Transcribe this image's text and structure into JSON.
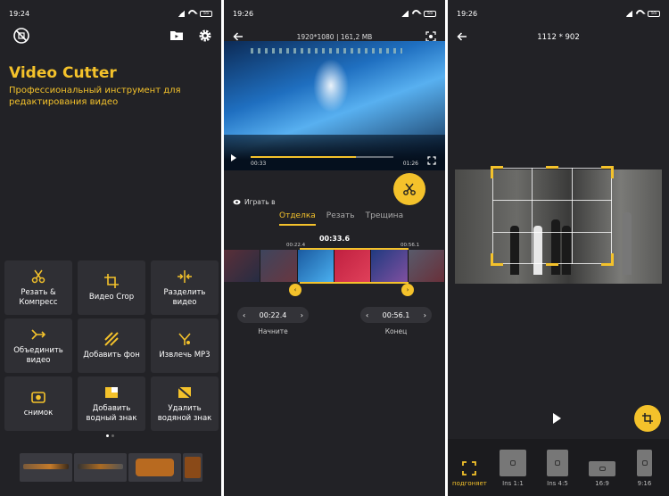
{
  "colors": {
    "accent": "#f4c22b",
    "bg": "#222226",
    "tile": "#2f2f34"
  },
  "screen1": {
    "status": {
      "time": "19:24",
      "battery": "55"
    },
    "app_title": "Video Cutter",
    "app_subtitle": "Профессиональный инструмент для редактирования видео",
    "tools": [
      {
        "label": "Резать & Компресс",
        "icon": "scissors-icon"
      },
      {
        "label": "Видео Crop",
        "icon": "crop-icon"
      },
      {
        "label": "Разделить видео",
        "icon": "split-icon"
      },
      {
        "label": "Объединить видео",
        "icon": "merge-icon"
      },
      {
        "label": "Добавить фон",
        "icon": "background-icon"
      },
      {
        "label": "Извлечь MP3",
        "icon": "extract-audio-icon"
      },
      {
        "label": "снимок",
        "icon": "camera-icon"
      },
      {
        "label": "Добавить водный знак",
        "icon": "add-watermark-icon"
      },
      {
        "label": "Удалить водяной знак",
        "icon": "remove-watermark-icon"
      }
    ]
  },
  "screen2": {
    "status": {
      "time": "19:26",
      "battery": "55"
    },
    "video_info": "1920*1080 | 161,2 MB",
    "player": {
      "current": "00:33",
      "total": "01:26",
      "progress": 0.74
    },
    "play_in_label": "Играть в",
    "tabs": [
      "Отделка",
      "Резать",
      "Трещина"
    ],
    "active_tab": 0,
    "current_time": "00:33.6",
    "range_start_marker": "00:22.4",
    "range_end_marker": "00:56.1",
    "start": {
      "value": "00:22.4",
      "label": "Начните"
    },
    "end": {
      "value": "00:56.1",
      "label": "Конец"
    }
  },
  "screen3": {
    "status": {
      "time": "19:26",
      "battery": "55"
    },
    "dimensions": "1112 * 902",
    "ratios": [
      {
        "label": "подгоняет",
        "active": true
      },
      {
        "label": "Ins 1:1"
      },
      {
        "label": "Ins 4:5"
      },
      {
        "label": "16:9"
      },
      {
        "label": "9:16"
      }
    ]
  }
}
